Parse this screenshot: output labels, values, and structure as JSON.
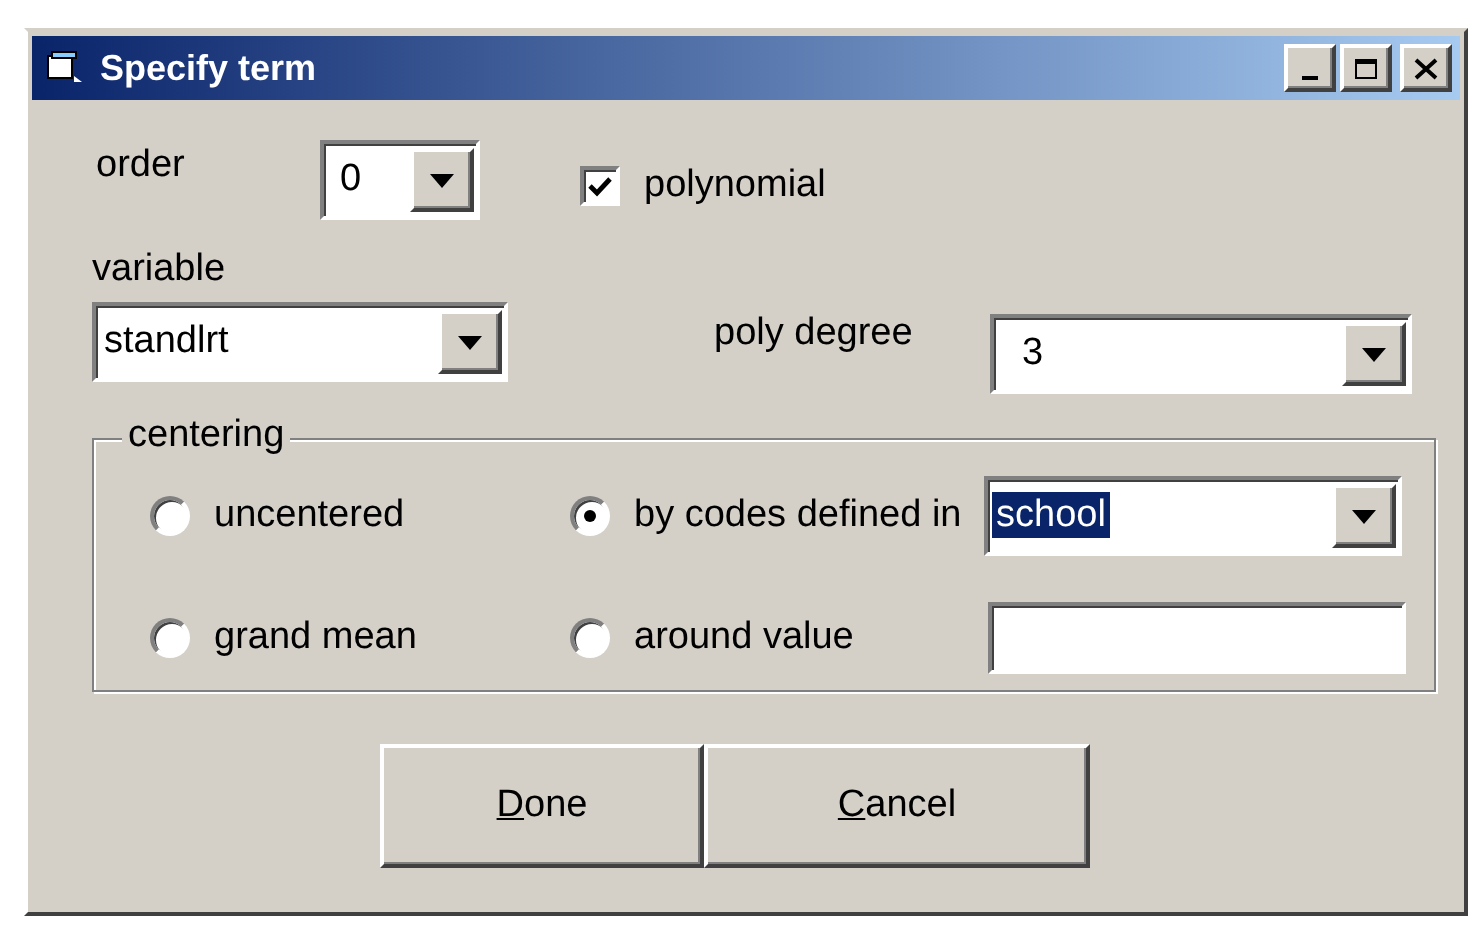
{
  "window": {
    "title": "Specify term"
  },
  "order": {
    "label": "order",
    "value": "0"
  },
  "polynomial": {
    "label": "polynomial",
    "checked": true
  },
  "variable": {
    "label": "variable",
    "value": "standlrt"
  },
  "poly_degree": {
    "label": "poly degree",
    "value": "3"
  },
  "centering": {
    "label": "centering",
    "options": [
      {
        "label": "uncentered",
        "selected": false
      },
      {
        "label": "by codes defined in",
        "selected": true
      },
      {
        "label": "grand mean",
        "selected": false
      },
      {
        "label": "around value",
        "selected": false
      }
    ],
    "codes_field": {
      "value": "school",
      "text_selected": true
    }
  },
  "buttons": [
    "Done",
    "Cancel"
  ]
}
